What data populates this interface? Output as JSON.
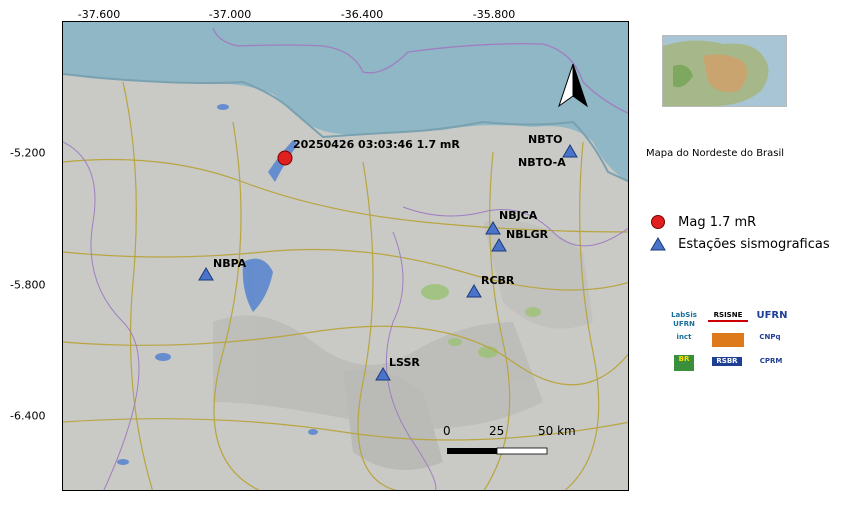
{
  "map": {
    "lon_ticks": [
      "-37.600",
      "-37.000",
      "-36.400",
      "-35.800"
    ],
    "lat_ticks": [
      "-5.200",
      "-5.800",
      "-6.400"
    ],
    "event_label": "20250426 03:03:46 1.7 mR",
    "stations": [
      {
        "code": "NBTO"
      },
      {
        "code": "NBTO-A"
      },
      {
        "code": "NBJCA"
      },
      {
        "code": "NBLGR"
      },
      {
        "code": "RCBR"
      },
      {
        "code": "NBPA"
      },
      {
        "code": "LSSR"
      }
    ],
    "scale_bar": {
      "labels": [
        "0",
        "25",
        "50 km"
      ]
    },
    "north_arrow_icon": "north-arrow-icon"
  },
  "inset": {
    "title": "Mapa do  Nordeste do Brasil"
  },
  "legend": {
    "event": {
      "label": "Mag 1.7 mR",
      "color": "#e02020"
    },
    "station": {
      "label": "Estações sismograficas",
      "color": "#4a74c9"
    }
  },
  "logos": [
    "LabSis UFRN",
    "RSISNE",
    "UFRN",
    "inct",
    "CNPq",
    "BR",
    "RSBR",
    "CPRM"
  ],
  "colors": {
    "sea": "#8fb7c6",
    "land": "#c9c9c6",
    "road": "#b8a640",
    "water": "#4d7fd0"
  }
}
